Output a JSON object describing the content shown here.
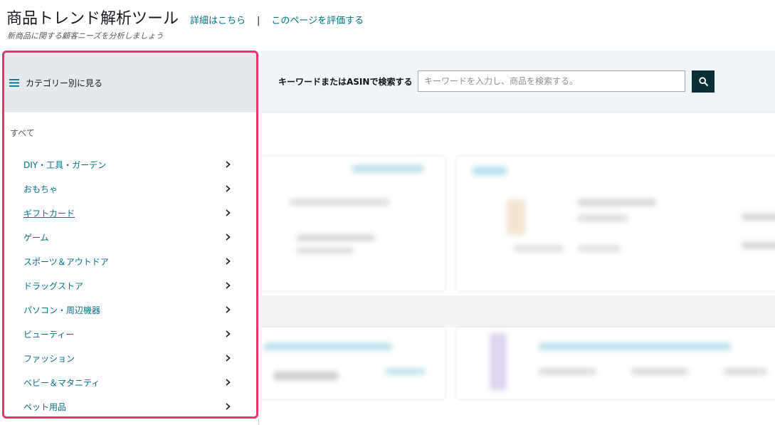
{
  "header": {
    "title": "商品トレンド解析ツール",
    "details_link": "詳細はこちら",
    "separator": "|",
    "rate_link": "このページを評価する",
    "subtitle": "新商品に関する顧客ニーズを分析しましょう"
  },
  "category_panel": {
    "header_label": "カテゴリー別に見る",
    "header_icon": "menu-icon",
    "all_label": "すべて",
    "items": [
      {
        "label": "DIY・工具・ガーデン"
      },
      {
        "label": "おもちゃ"
      },
      {
        "label": "ギフトカード"
      },
      {
        "label": "ゲーム"
      },
      {
        "label": "スポーツ＆アウトドア"
      },
      {
        "label": "ドラッグストア"
      },
      {
        "label": "パソコン・周辺機器"
      },
      {
        "label": "ビューティー"
      },
      {
        "label": "ファッション"
      },
      {
        "label": "ベビー＆マタニティ"
      },
      {
        "label": "ペット用品"
      }
    ],
    "chevron_icon": "chevron-right-icon"
  },
  "search": {
    "label": "キーワードまたはASINで検索する",
    "placeholder": "キーワードを入力し、商品を検索する。",
    "button_icon": "search-icon"
  },
  "colors": {
    "accent_link": "#007185",
    "panel_highlight": "#e8336b",
    "search_button": "#0b2f36",
    "panel_header_bg": "#e3e9ec"
  }
}
